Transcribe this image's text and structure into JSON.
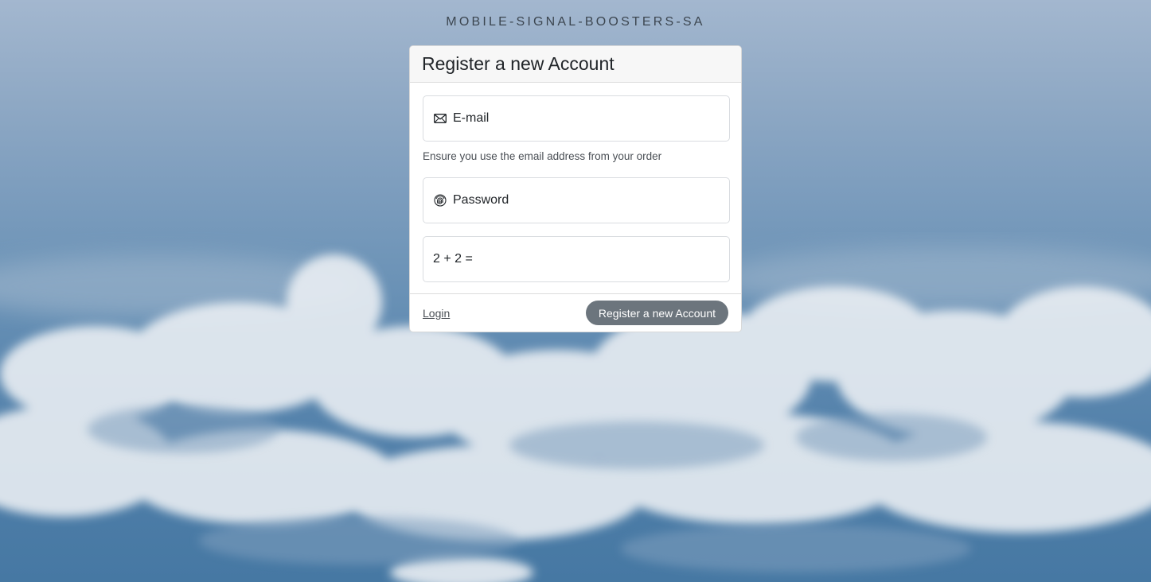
{
  "site": {
    "title": "MOBILE-SIGNAL-BOOSTERS-SA"
  },
  "card": {
    "title": "Register a new Account",
    "email": {
      "label": "E-mail",
      "icon": "envelope-icon",
      "help": "Ensure you use the email address from your order"
    },
    "password": {
      "label": "Password",
      "icon": "fingerprint-icon"
    },
    "captcha": {
      "label": "2 + 2 ="
    },
    "footer": {
      "login_label": "Login",
      "submit_label": "Register a new Account"
    }
  },
  "colors": {
    "submit_bg": "#6c757d",
    "background_sky": "#6f95b8"
  }
}
